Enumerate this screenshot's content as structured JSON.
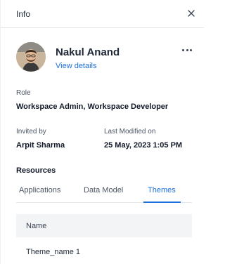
{
  "header": {
    "title": "Info",
    "close_icon": "close-icon"
  },
  "user": {
    "name": "Nakul Anand",
    "view_details_label": "View details",
    "more_icon": "more-horizontal-icon"
  },
  "role": {
    "label": "Role",
    "value": "Workspace Admin, Workspace Developer"
  },
  "invited_by": {
    "label": "Invited by",
    "value": "Arpit Sharma"
  },
  "last_modified": {
    "label": "Last Modified on",
    "value": "25 May, 2023 1:05 PM"
  },
  "resources": {
    "title": "Resources",
    "tabs": [
      {
        "label": "Applications",
        "active": false
      },
      {
        "label": "Data Model",
        "active": false
      },
      {
        "label": "Themes",
        "active": true
      }
    ],
    "table": {
      "columns": [
        "Name"
      ],
      "rows": [
        [
          "Theme_name 1"
        ]
      ]
    }
  },
  "colors": {
    "accent": "#1e6fd9",
    "table_header_bg": "#f3f4f6",
    "divider": "#e5e7eb"
  }
}
